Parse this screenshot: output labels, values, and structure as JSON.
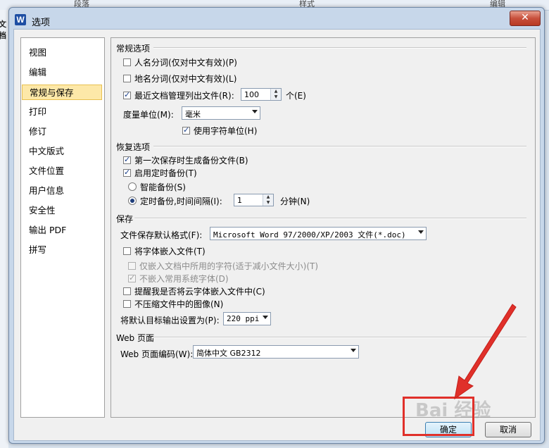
{
  "background": {
    "tabs": [
      "段落",
      "样式",
      "编辑"
    ],
    "left_label": "文档"
  },
  "dialog": {
    "title": "选项",
    "icon_letter": "W",
    "close_glyph": "✕"
  },
  "nav": {
    "items": [
      {
        "label": "视图"
      },
      {
        "label": "编辑"
      },
      {
        "label": "常规与保存"
      },
      {
        "label": "打印"
      },
      {
        "label": "修订"
      },
      {
        "label": "中文版式"
      },
      {
        "label": "文件位置"
      },
      {
        "label": "用户信息"
      },
      {
        "label": "安全性"
      },
      {
        "label": "输出 PDF"
      },
      {
        "label": "拼写"
      }
    ],
    "selected": "常规与保存"
  },
  "general": {
    "heading": "常规选项",
    "person_name": {
      "label": "人名分词(仅对中文有效)(P)",
      "checked": false
    },
    "place_name": {
      "label": "地名分词(仅对中文有效)(L)",
      "checked": false
    },
    "recent_docs": {
      "label": "最近文档管理列出文件(R):",
      "checked": true,
      "value": "100",
      "unit": "个(E)"
    },
    "measure_label": "度量单位(M):",
    "measure_value": "毫米",
    "char_units": {
      "label": "使用字符单位(H)",
      "checked": true
    }
  },
  "recovery": {
    "heading": "恢复选项",
    "backup_first": {
      "label": "第一次保存时生成备份文件(B)",
      "checked": true
    },
    "timed_backup": {
      "label": "启用定时备份(T)",
      "checked": true
    },
    "smart_backup": {
      "label": "智能备份(S)",
      "selected": false
    },
    "interval_backup": {
      "label": "定时备份,时间间隔(I):",
      "selected": true,
      "value": "1",
      "unit": "分钟(N)"
    }
  },
  "save": {
    "heading": "保存",
    "default_format_label": "文件保存默认格式(F):",
    "default_format_value": "Microsoft Word 97/2000/XP/2003 文件(*.doc)",
    "embed_fonts": {
      "label": "将字体嵌入文件(T)",
      "checked": false
    },
    "embed_used_chars": {
      "label": "仅嵌入文档中所用的字符(适于减小文件大小)(T)",
      "checked": false
    },
    "no_common_fonts": {
      "label": "不嵌入常用系统字体(D)",
      "checked": true
    },
    "remind_cloud": {
      "label": "提醒我是否将云字体嵌入文件中(C)",
      "checked": false
    },
    "no_compress": {
      "label": "不压缩文件中的图像(N)",
      "checked": false
    },
    "resolution_label": "将默认目标输出设置为(P):",
    "resolution_value": "220 ppi"
  },
  "web": {
    "heading": "Web 页面",
    "encoding_label": "Web 页面编码(W):",
    "encoding_value": "简体中文 GB2312"
  },
  "buttons": {
    "ok": "确定",
    "cancel": "取消"
  },
  "annotation": {
    "watermark": "Bai 经验",
    "arrow_color": "#e0302a"
  }
}
